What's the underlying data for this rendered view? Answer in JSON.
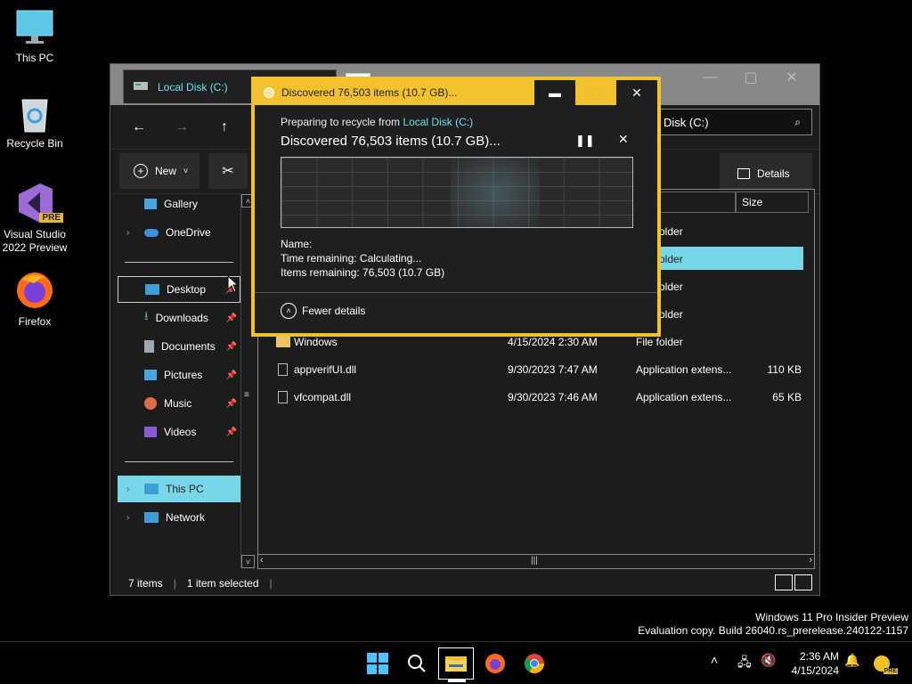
{
  "desktop": {
    "icons": [
      {
        "label": "This PC"
      },
      {
        "label": "Recycle Bin"
      },
      {
        "label": "Visual Studio 2022 Preview",
        "badge": "PRE"
      },
      {
        "label": "Firefox"
      }
    ]
  },
  "explorer": {
    "tab_title": "Local Disk (C:)",
    "address": "Disk (C:)",
    "toolbar": {
      "new_label": "New",
      "details_label": "Details"
    },
    "sidebar": [
      {
        "label": "Gallery"
      },
      {
        "label": "OneDrive"
      },
      {
        "label": "Desktop"
      },
      {
        "label": "Downloads"
      },
      {
        "label": "Documents"
      },
      {
        "label": "Pictures"
      },
      {
        "label": "Music"
      },
      {
        "label": "Videos"
      },
      {
        "label": "This PC"
      },
      {
        "label": "Network"
      }
    ],
    "columns": {
      "size": "Size"
    },
    "rows": [
      {
        "name": "",
        "date": "",
        "type": "older",
        "size": ""
      },
      {
        "name": "",
        "date": "",
        "type": "older",
        "size": ""
      },
      {
        "name": "",
        "date": "",
        "type": "older",
        "size": ""
      },
      {
        "name": "",
        "date": "",
        "type": "older",
        "size": ""
      },
      {
        "name": "Windows",
        "date": "4/15/2024 2:30 AM",
        "type": "File folder",
        "size": ""
      },
      {
        "name": "appverifUI.dll",
        "date": "9/30/2023 7:47 AM",
        "type": "Application extens...",
        "size": "110 KB"
      },
      {
        "name": "vfcompat.dll",
        "date": "9/30/2023 7:46 AM",
        "type": "Application extens...",
        "size": "65 KB"
      }
    ],
    "status": {
      "items": "7 items",
      "selected": "1 item selected"
    }
  },
  "dialog": {
    "title": "Discovered 76,503 items (10.7 GB)...",
    "sub_prefix": "Preparing to recycle from ",
    "sub_link": "Local Disk (C:)",
    "heading": "Discovered 76,503 items (10.7 GB)...",
    "name_label": "Name:",
    "time_remaining": "Time remaining:  Calculating...",
    "items_remaining": "Items remaining:  76,503 (10.7 GB)",
    "fewer_details": "Fewer details"
  },
  "watermark": {
    "line1": "Windows 11 Pro Insider Preview",
    "line2": "Evaluation copy. Build 26040.rs_prerelease.240122-1157"
  },
  "taskbar": {
    "time": "2:36 AM",
    "date": "4/15/2024",
    "pre_badge": "PRE"
  },
  "colors": {
    "accent": "#f2c12e",
    "selection": "#77d7e8",
    "link": "#6ce0f0"
  }
}
